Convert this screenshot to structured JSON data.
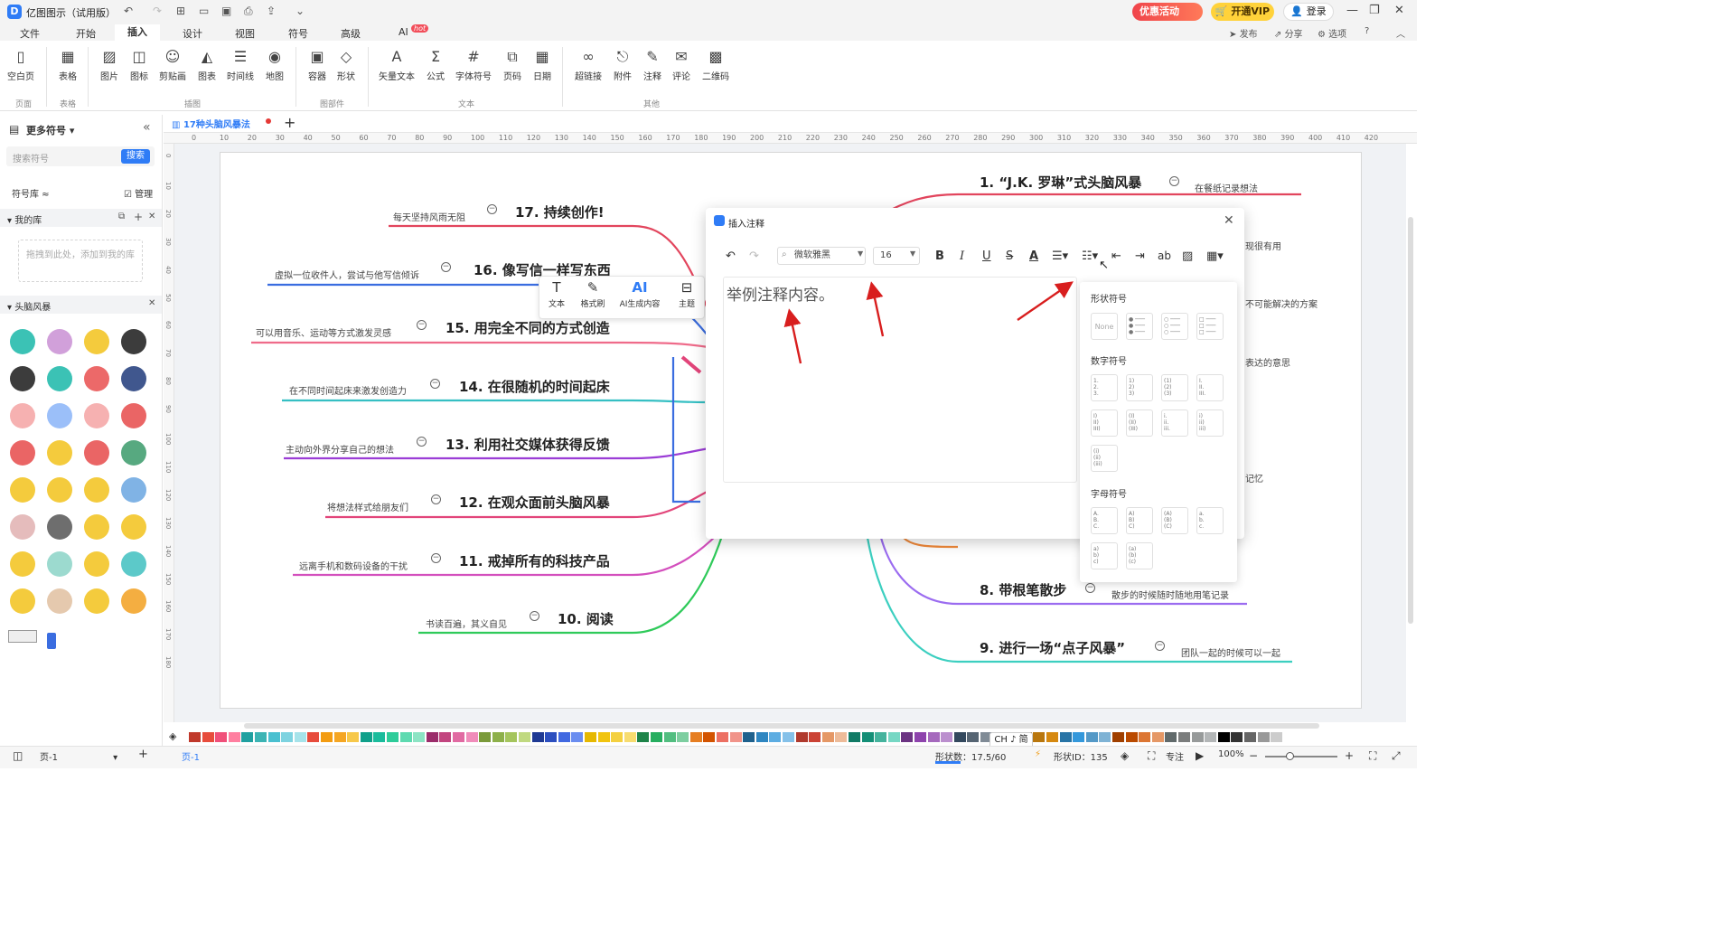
{
  "app": {
    "title": "亿图图示（试用版）",
    "promo": "优惠活动",
    "vip": "开通VIP",
    "login": "登录"
  },
  "menus": [
    "文件",
    "开始",
    "插入",
    "设计",
    "视图",
    "符号",
    "高级",
    "AI"
  ],
  "menu_badge": "hot",
  "toolbar_right": [
    "发布",
    "分享",
    "选项"
  ],
  "ribbon": {
    "buttons": [
      "空白页",
      "表格",
      "图片",
      "图标",
      "剪贴画",
      "图表",
      "时间线",
      "地图",
      "容器",
      "形状",
      "矢量文本",
      "公式",
      "字体符号",
      "页码",
      "日期",
      "超链接",
      "附件",
      "注释",
      "评论",
      "二维码"
    ],
    "groups": [
      "页面",
      "表格",
      "插图",
      "图部件",
      "文本",
      "其他"
    ]
  },
  "left_panel": {
    "header": "更多符号",
    "search_placeholder": "搜索符号",
    "search_button": "搜索",
    "library": "符号库",
    "manage": "管理",
    "my_library": "我的库",
    "drop_hint": "拖拽到此处，添加到我的库",
    "category": "头脑风暴"
  },
  "document": {
    "tab": "17种头脑风暴法"
  },
  "ruler_labels": [
    "0",
    "10",
    "20",
    "30",
    "40",
    "50",
    "60",
    "70",
    "80",
    "90",
    "100",
    "110",
    "120",
    "130",
    "140",
    "150",
    "160",
    "170",
    "180",
    "190",
    "200",
    "210",
    "220",
    "230",
    "240",
    "250",
    "260",
    "270",
    "280",
    "290",
    "300",
    "310",
    "320",
    "330",
    "340",
    "350",
    "360",
    "370",
    "380",
    "390",
    "400",
    "410",
    "420"
  ],
  "vruler_labels": [
    "0",
    "10",
    "20",
    "30",
    "40",
    "50",
    "60",
    "70",
    "80",
    "90",
    "100",
    "110",
    "120",
    "130",
    "140",
    "150",
    "160",
    "170",
    "180"
  ],
  "mindmap": {
    "left": [
      {
        "topic": "17. 持续创作!",
        "note": "每天坚持风雨无阻"
      },
      {
        "topic": "16. 像写信一样写东西",
        "note": "虚拟一位收件人，尝试与他写信倾诉"
      },
      {
        "topic": "15. 用完全不同的方式创造",
        "note": "可以用音乐、运动等方式激发灵感"
      },
      {
        "topic": "14. 在很随机的时间起床",
        "note": "在不同时间起床来激发创造力"
      },
      {
        "topic": "13. 利用社交媒体获得反馈",
        "note": "主动向外界分享自己的想法"
      },
      {
        "topic": "12. 在观众面前头脑风暴",
        "note": "将想法样式给朋友们"
      },
      {
        "topic": "11. 戒掉所有的科技产品",
        "note": "远离手机和数码设备的干扰"
      },
      {
        "topic": "10. 阅读",
        "note": "书读百遍，其义自见"
      }
    ],
    "right": [
      {
        "topic": "1. “J.K. 罗琳”式头脑风暴",
        "note": "在餐纸记录想法"
      },
      {
        "topic": "8. 带根笔散步",
        "note": "散步的时候随时随地用笔记录"
      },
      {
        "topic": "9. 进行一场“点子风暴”",
        "note": "团队一起的时候可以一起"
      }
    ],
    "partial_notes": [
      "现很有用",
      "不可能解决的方案",
      "表达的意思",
      "记忆"
    ]
  },
  "float_toolbar": [
    "文本",
    "格式刷",
    "AI生成内容",
    "主题"
  ],
  "dialog": {
    "title": "插入注释",
    "font": "微软雅黑",
    "size": "16",
    "content": "举例注释内容。",
    "list_panel": {
      "shape_heading": "形状符号",
      "none_label": "None",
      "number_heading": "数字符号",
      "letter_heading": "字母符号",
      "number_samples": [
        "1.\n2.\n3.",
        "1)\n2)\n3)",
        "(1)\n(2)\n(3)",
        "I.\nII.\nIII.",
        "I)\nII)\nIII)",
        "(I)\n(II)\n(III)",
        "i.\nii.\niii.",
        "i)\nii)\niii)",
        "(i)\n(ii)\n(iii)"
      ],
      "letter_samples": [
        "A.\nB.\nC.",
        "A)\nB)\nC)",
        "(A)\n(B)\n(C)",
        "a.\nb.\nc.",
        "a)\nb)\nc)",
        "(a)\n(b)\n(c)"
      ]
    }
  },
  "status": {
    "page_selector": "页-1",
    "page_tab": "页-1",
    "shape_count": "形状数：17.5/60",
    "ime": "CH ♪ 简",
    "shape_id": "形状ID：135",
    "focus": "专注",
    "zoom": "100%"
  },
  "palette": [
    "#c0392b",
    "#e74c3c",
    "#f0507a",
    "#ff7fa0",
    "#20a0a0",
    "#3cb4b4",
    "#4ac0d0",
    "#7dd3e0",
    "#a6e3ea",
    "#e74c3c",
    "#f39c12",
    "#f5a623",
    "#f7c84a",
    "#10a08a",
    "#1abc9c",
    "#2ecc9a",
    "#5edab0",
    "#8ce4c4",
    "#9b2d6b",
    "#c2457f",
    "#e16aa2",
    "#f08cba",
    "#7a9a3a",
    "#8db04a",
    "#a5c55d",
    "#c0d980",
    "#1f3a93",
    "#2c4fbf",
    "#4169e1",
    "#6a8df0",
    "#e6b800",
    "#f1c40f",
    "#f4d03f",
    "#f7dc6f",
    "#1e8449",
    "#27ae60",
    "#52be80",
    "#7dcea0",
    "#e67e22",
    "#d35400",
    "#ec7063",
    "#f1948a",
    "#1f618d",
    "#2e86c1",
    "#5dade2",
    "#85c1e9",
    "#b03a2e",
    "#cb4335",
    "#e59866",
    "#edbb99",
    "#117a65",
    "#148f77",
    "#45b39d",
    "#76d7c4",
    "#6c3483",
    "#8e44ad",
    "#a569bd",
    "#bb8fce",
    "#34495e",
    "#566573",
    "#808b96",
    "#aab7b8",
    "#784212",
    "#9c640c",
    "#b9770e",
    "#d68910",
    "#2874a6",
    "#3498db",
    "#5499c7",
    "#7fb3d5",
    "#a04000",
    "#ba4a00",
    "#dc7633",
    "#e59866",
    "#616a6b",
    "#7b7d7d",
    "#979a9a",
    "#b3b6b7",
    "#000000",
    "#333333",
    "#666666",
    "#999999",
    "#cccccc",
    "#ffffff"
  ]
}
